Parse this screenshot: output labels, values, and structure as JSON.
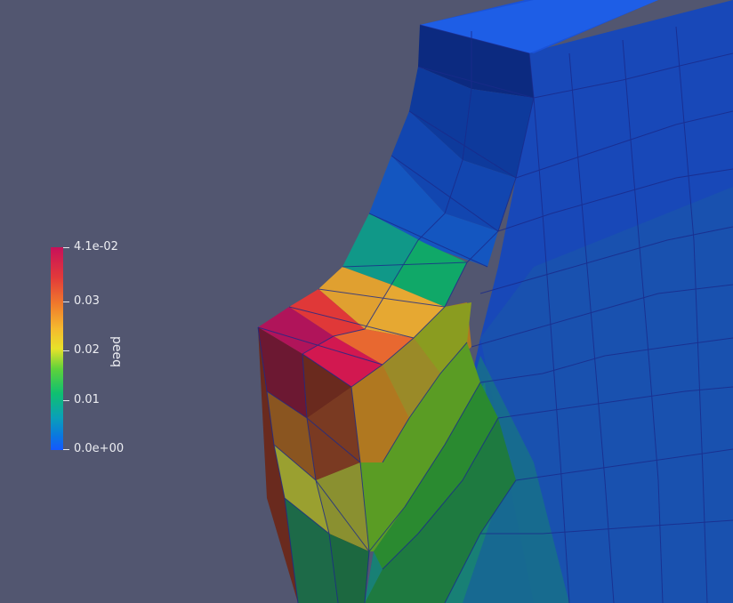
{
  "viewport": {
    "background_color": "#525670",
    "mesh_edge_color": "#1a2a8a"
  },
  "colorbar": {
    "title": "peeq",
    "range": [
      0.0,
      0.041
    ],
    "ticks": [
      {
        "value": 0.041,
        "label": "4.1e-02"
      },
      {
        "value": 0.03,
        "label": "0.03"
      },
      {
        "value": 0.02,
        "label": "0.02"
      },
      {
        "value": 0.01,
        "label": "0.01"
      },
      {
        "value": 0.0,
        "label": "0.0e+00"
      }
    ],
    "colormap": [
      "#c8105a",
      "#e23a3a",
      "#f07a2c",
      "#f5b92e",
      "#e8e22a",
      "#5fd23a",
      "#0fc070",
      "#0aa0b8",
      "#0a78e0",
      "#1458ff"
    ]
  }
}
